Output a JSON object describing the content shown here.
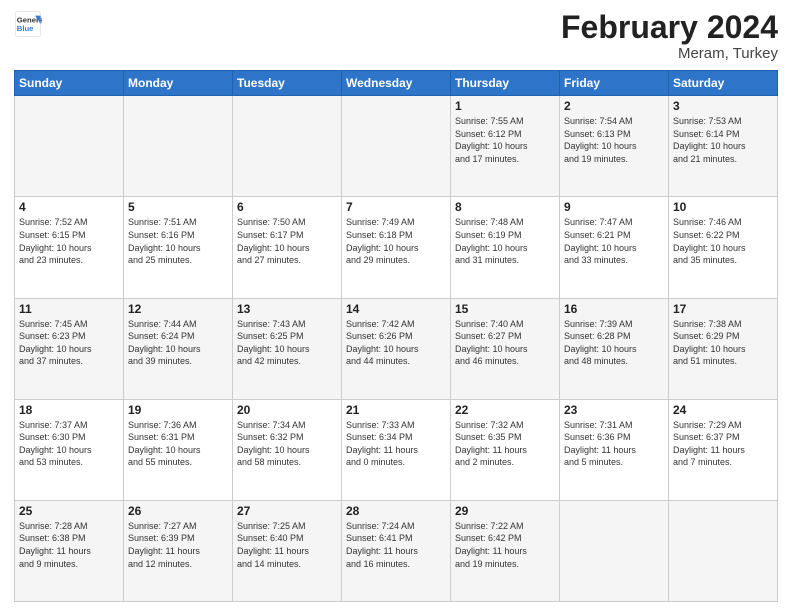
{
  "header": {
    "logo_general": "General",
    "logo_blue": "Blue",
    "month_year": "February 2024",
    "location": "Meram, Turkey"
  },
  "weekdays": [
    "Sunday",
    "Monday",
    "Tuesday",
    "Wednesday",
    "Thursday",
    "Friday",
    "Saturday"
  ],
  "weeks": [
    [
      {
        "day": "",
        "info": ""
      },
      {
        "day": "",
        "info": ""
      },
      {
        "day": "",
        "info": ""
      },
      {
        "day": "",
        "info": ""
      },
      {
        "day": "1",
        "info": "Sunrise: 7:55 AM\nSunset: 6:12 PM\nDaylight: 10 hours\nand 17 minutes."
      },
      {
        "day": "2",
        "info": "Sunrise: 7:54 AM\nSunset: 6:13 PM\nDaylight: 10 hours\nand 19 minutes."
      },
      {
        "day": "3",
        "info": "Sunrise: 7:53 AM\nSunset: 6:14 PM\nDaylight: 10 hours\nand 21 minutes."
      }
    ],
    [
      {
        "day": "4",
        "info": "Sunrise: 7:52 AM\nSunset: 6:15 PM\nDaylight: 10 hours\nand 23 minutes."
      },
      {
        "day": "5",
        "info": "Sunrise: 7:51 AM\nSunset: 6:16 PM\nDaylight: 10 hours\nand 25 minutes."
      },
      {
        "day": "6",
        "info": "Sunrise: 7:50 AM\nSunset: 6:17 PM\nDaylight: 10 hours\nand 27 minutes."
      },
      {
        "day": "7",
        "info": "Sunrise: 7:49 AM\nSunset: 6:18 PM\nDaylight: 10 hours\nand 29 minutes."
      },
      {
        "day": "8",
        "info": "Sunrise: 7:48 AM\nSunset: 6:19 PM\nDaylight: 10 hours\nand 31 minutes."
      },
      {
        "day": "9",
        "info": "Sunrise: 7:47 AM\nSunset: 6:21 PM\nDaylight: 10 hours\nand 33 minutes."
      },
      {
        "day": "10",
        "info": "Sunrise: 7:46 AM\nSunset: 6:22 PM\nDaylight: 10 hours\nand 35 minutes."
      }
    ],
    [
      {
        "day": "11",
        "info": "Sunrise: 7:45 AM\nSunset: 6:23 PM\nDaylight: 10 hours\nand 37 minutes."
      },
      {
        "day": "12",
        "info": "Sunrise: 7:44 AM\nSunset: 6:24 PM\nDaylight: 10 hours\nand 39 minutes."
      },
      {
        "day": "13",
        "info": "Sunrise: 7:43 AM\nSunset: 6:25 PM\nDaylight: 10 hours\nand 42 minutes."
      },
      {
        "day": "14",
        "info": "Sunrise: 7:42 AM\nSunset: 6:26 PM\nDaylight: 10 hours\nand 44 minutes."
      },
      {
        "day": "15",
        "info": "Sunrise: 7:40 AM\nSunset: 6:27 PM\nDaylight: 10 hours\nand 46 minutes."
      },
      {
        "day": "16",
        "info": "Sunrise: 7:39 AM\nSunset: 6:28 PM\nDaylight: 10 hours\nand 48 minutes."
      },
      {
        "day": "17",
        "info": "Sunrise: 7:38 AM\nSunset: 6:29 PM\nDaylight: 10 hours\nand 51 minutes."
      }
    ],
    [
      {
        "day": "18",
        "info": "Sunrise: 7:37 AM\nSunset: 6:30 PM\nDaylight: 10 hours\nand 53 minutes."
      },
      {
        "day": "19",
        "info": "Sunrise: 7:36 AM\nSunset: 6:31 PM\nDaylight: 10 hours\nand 55 minutes."
      },
      {
        "day": "20",
        "info": "Sunrise: 7:34 AM\nSunset: 6:32 PM\nDaylight: 10 hours\nand 58 minutes."
      },
      {
        "day": "21",
        "info": "Sunrise: 7:33 AM\nSunset: 6:34 PM\nDaylight: 11 hours\nand 0 minutes."
      },
      {
        "day": "22",
        "info": "Sunrise: 7:32 AM\nSunset: 6:35 PM\nDaylight: 11 hours\nand 2 minutes."
      },
      {
        "day": "23",
        "info": "Sunrise: 7:31 AM\nSunset: 6:36 PM\nDaylight: 11 hours\nand 5 minutes."
      },
      {
        "day": "24",
        "info": "Sunrise: 7:29 AM\nSunset: 6:37 PM\nDaylight: 11 hours\nand 7 minutes."
      }
    ],
    [
      {
        "day": "25",
        "info": "Sunrise: 7:28 AM\nSunset: 6:38 PM\nDaylight: 11 hours\nand 9 minutes."
      },
      {
        "day": "26",
        "info": "Sunrise: 7:27 AM\nSunset: 6:39 PM\nDaylight: 11 hours\nand 12 minutes."
      },
      {
        "day": "27",
        "info": "Sunrise: 7:25 AM\nSunset: 6:40 PM\nDaylight: 11 hours\nand 14 minutes."
      },
      {
        "day": "28",
        "info": "Sunrise: 7:24 AM\nSunset: 6:41 PM\nDaylight: 11 hours\nand 16 minutes."
      },
      {
        "day": "29",
        "info": "Sunrise: 7:22 AM\nSunset: 6:42 PM\nDaylight: 11 hours\nand 19 minutes."
      },
      {
        "day": "",
        "info": ""
      },
      {
        "day": "",
        "info": ""
      }
    ]
  ]
}
